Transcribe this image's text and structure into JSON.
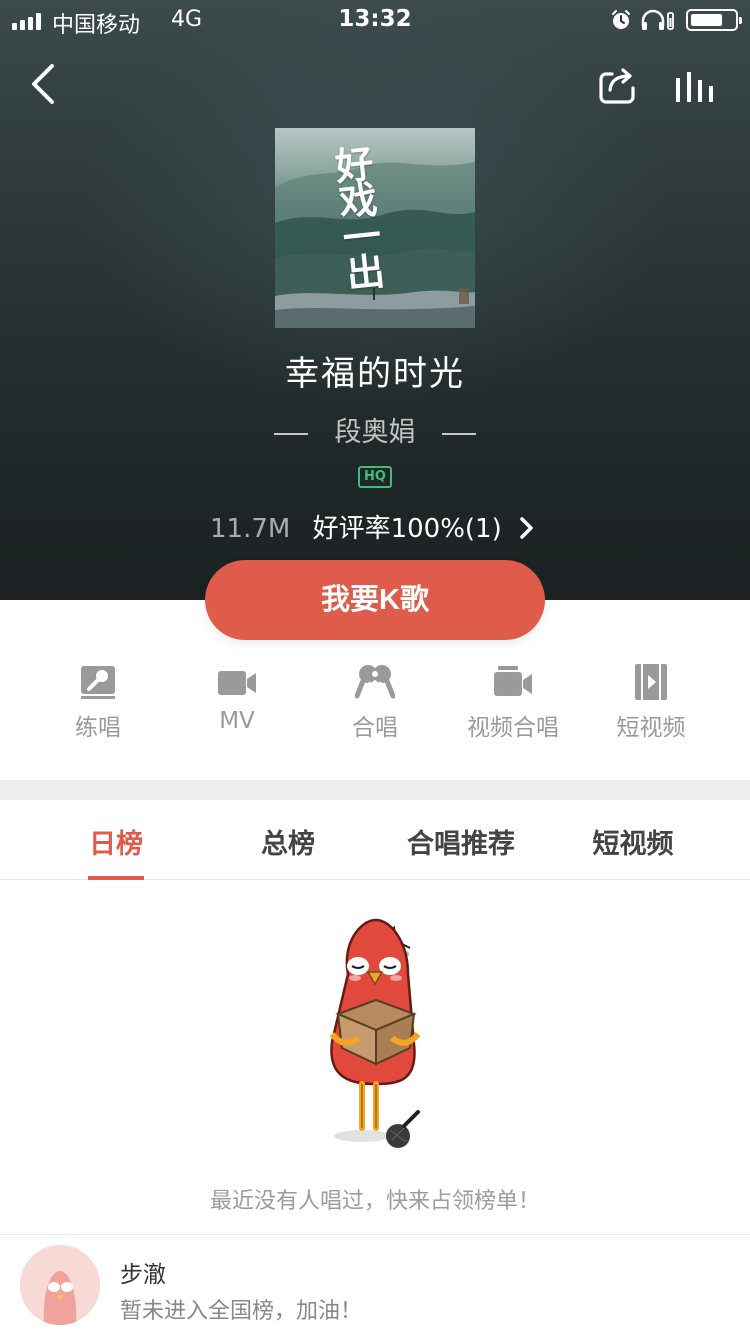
{
  "status_bar": {
    "carrier": "中国移动",
    "network": "4G",
    "time": "13:32",
    "signal_bars": 4,
    "battery_level": 0.7
  },
  "nav": {
    "back_icon": "chevron-left-icon",
    "share_icon": "share-icon",
    "equalizer_icon": "equalizer-icon"
  },
  "song": {
    "title": "幸福的时光",
    "artist": "段奥娟",
    "quality_badge": "HQ",
    "file_size": "11.7M",
    "rating": "好评率100%(1)",
    "album_cover_text": "好戏一出"
  },
  "primary_action": {
    "label": "我要K歌"
  },
  "actions": [
    {
      "label": "练唱",
      "icon": "practice-icon"
    },
    {
      "label": "MV",
      "icon": "video-camera-icon"
    },
    {
      "label": "合唱",
      "icon": "duet-mic-icon"
    },
    {
      "label": "视频合唱",
      "icon": "video-duet-icon"
    },
    {
      "label": "短视频",
      "icon": "short-video-icon"
    }
  ],
  "tabs": [
    {
      "label": "日榜",
      "active": true
    },
    {
      "label": "总榜",
      "active": false
    },
    {
      "label": "合唱推荐",
      "active": false
    },
    {
      "label": "短视频",
      "active": false
    }
  ],
  "empty_state": {
    "message": "最近没有人唱过，快来占领榜单！"
  },
  "user": {
    "name": "步澈",
    "status": "暂未进入全国榜，加油！"
  },
  "colors": {
    "accent": "#df5c4b",
    "hq_green": "#3fbf74",
    "muted_text": "#9a9a9a"
  }
}
